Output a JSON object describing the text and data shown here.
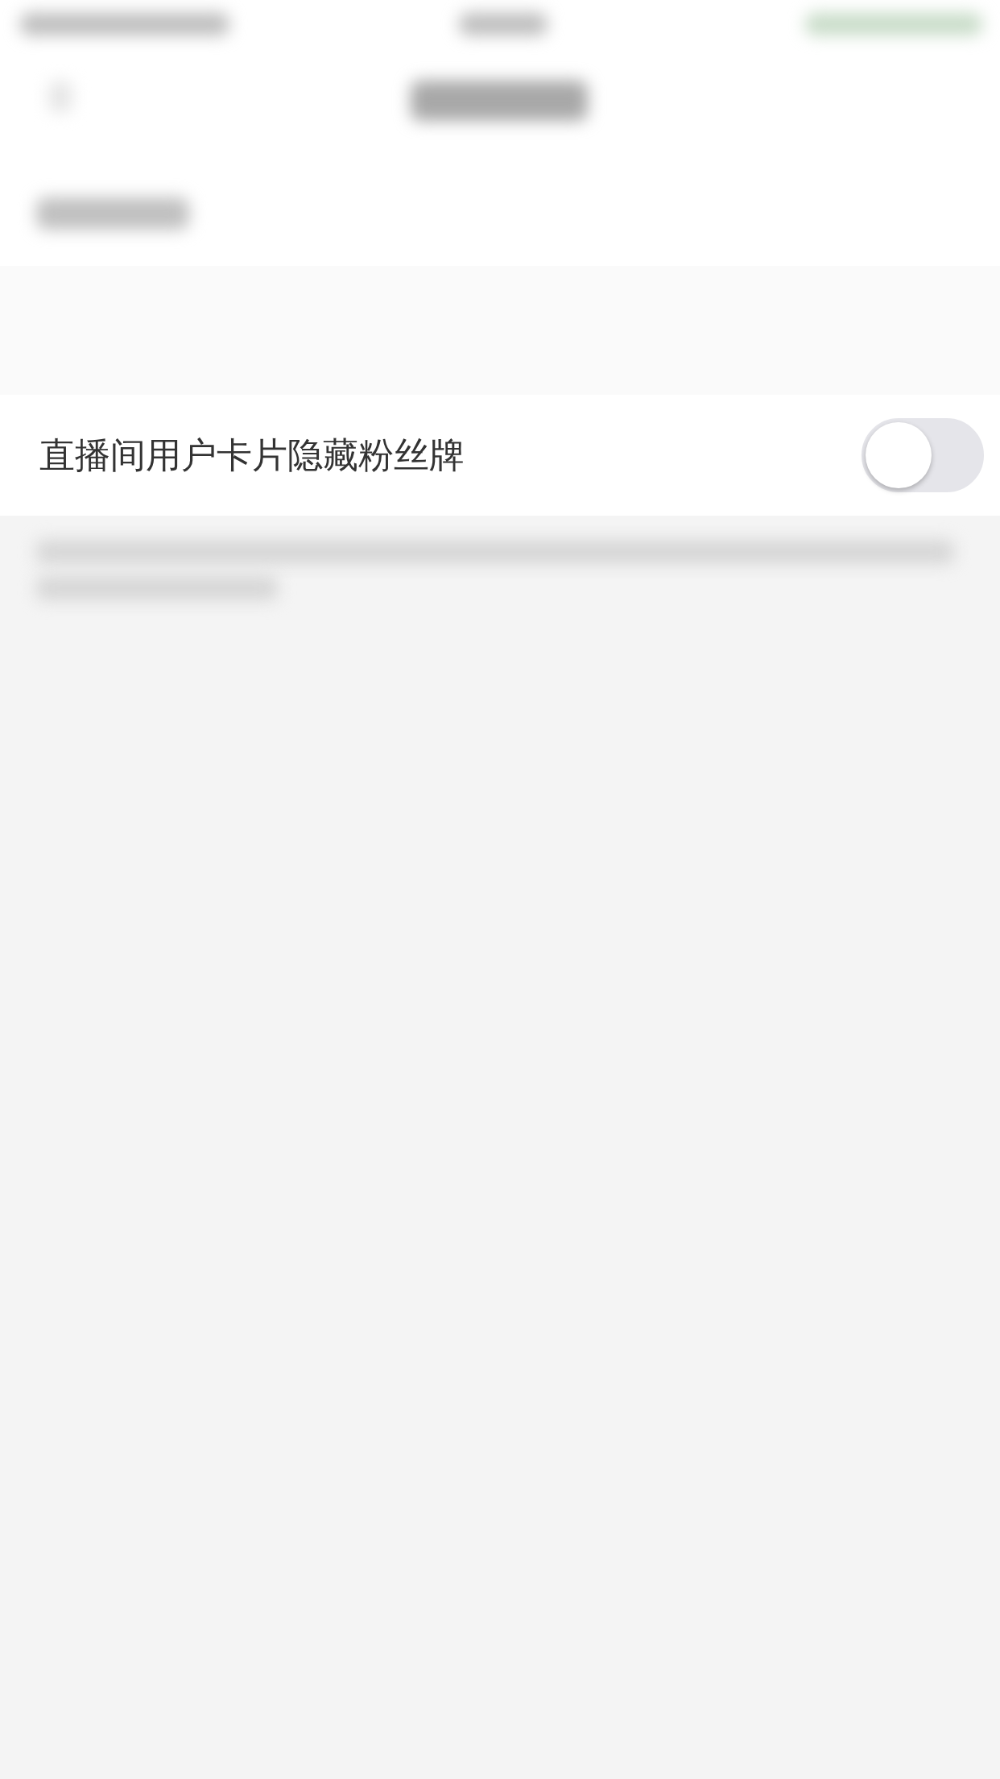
{
  "settings": [
    {
      "label": "直播间用户卡片隐藏粉丝牌",
      "on": false
    }
  ]
}
